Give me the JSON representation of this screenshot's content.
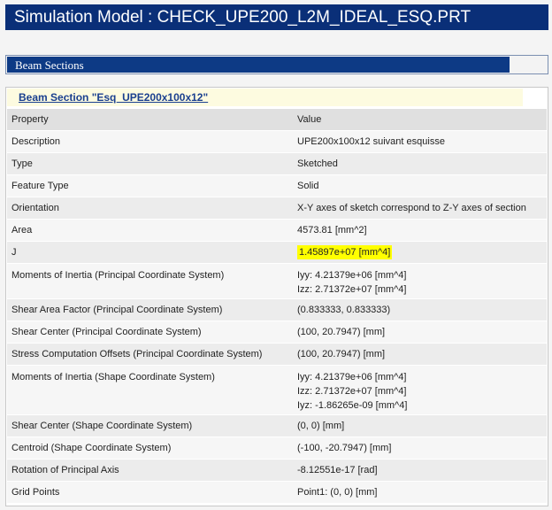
{
  "window": {
    "title": "Simulation Model : CHECK_UPE200_L2M_IDEAL_ESQ.PRT"
  },
  "beam_sections": {
    "label": "Beam Sections"
  },
  "section": {
    "link_text": "Beam Section \"Esq_UPE200x100x12\"",
    "columns": {
      "property": "Property",
      "value": "Value"
    },
    "rows": [
      {
        "key": "Description",
        "value": "UPE200x100x12 suivant esquisse"
      },
      {
        "key": "Type",
        "value": "Sketched"
      },
      {
        "key": "Feature Type",
        "value": "Solid"
      },
      {
        "key": "Orientation",
        "value": "X-Y axes of sketch correspond to Z-Y axes of section"
      },
      {
        "key": "Area",
        "value": "4573.81 [mm^2]"
      },
      {
        "key": "J",
        "value": "1.45897e+07 [mm^4]"
      },
      {
        "key": "Moments of Inertia (Principal Coordinate System)",
        "lines": [
          "Iyy: 4.21379e+06 [mm^4]",
          "Izz: 2.71372e+07 [mm^4]"
        ]
      },
      {
        "key": "Shear Area Factor (Principal Coordinate System)",
        "value": "(0.833333, 0.833333)"
      },
      {
        "key": "Shear Center (Principal Coordinate System)",
        "value": "(100, 20.7947) [mm]"
      },
      {
        "key": "Stress Computation Offsets (Principal Coordinate System)",
        "value": "(100, 20.7947) [mm]"
      },
      {
        "key": "Moments of Inertia (Shape Coordinate System)",
        "lines": [
          "Iyy: 4.21379e+06 [mm^4]",
          "Izz: 2.71372e+07 [mm^4]",
          "Iyz: -1.86265e-09 [mm^4]"
        ]
      },
      {
        "key": "Shear Center (Shape Coordinate System)",
        "value": "(0, 0) [mm]"
      },
      {
        "key": "Centroid (Shape Coordinate System)",
        "value": "(-100, -20.7947) [mm]"
      },
      {
        "key": "Rotation of Principal Axis",
        "value": "-8.12551e-17 [rad]"
      },
      {
        "key": "Grid Points",
        "value": "Point1: (0, 0) [mm]"
      }
    ]
  },
  "colors": {
    "title_bg": "#0a2f78",
    "section_bar": "#0d3a85",
    "highlight": "#ffff00",
    "link": "#1a3f8f"
  }
}
